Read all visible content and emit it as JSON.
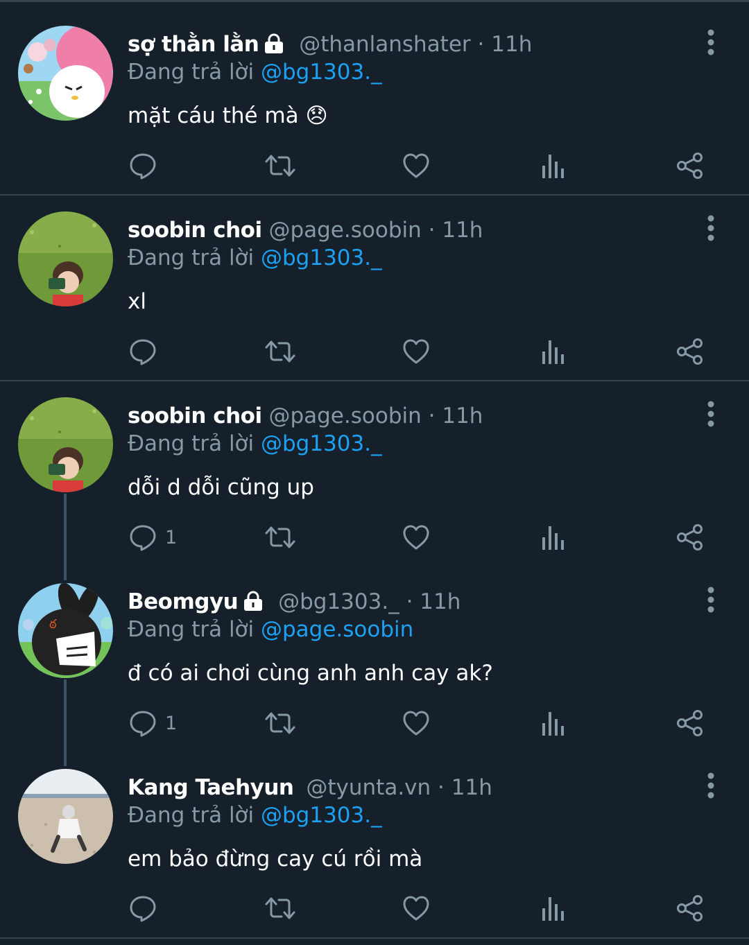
{
  "tweets": [
    {
      "name": "sợ thằn lằn",
      "handle": "@thanlanshater",
      "time": "11h",
      "locked": true,
      "reply_prefix": "Đang trả lời",
      "reply_to": "@bg1303._",
      "text": "mặt cáu thé mà 😞",
      "reply_count": ""
    },
    {
      "name": "soobin choi",
      "handle": "@page.soobin",
      "time": "11h",
      "locked": false,
      "reply_prefix": "Đang trả lời",
      "reply_to": "@bg1303._",
      "text": "xl",
      "reply_count": ""
    },
    {
      "name": "soobin choi",
      "handle": "@page.soobin",
      "time": "11h",
      "locked": false,
      "reply_prefix": "Đang trả lời",
      "reply_to": "@bg1303._",
      "text": "dỗi d dỗi cũng up",
      "reply_count": "1"
    },
    {
      "name": "Beomgyu",
      "handle": "@bg1303._",
      "time": "11h",
      "locked": true,
      "reply_prefix": "Đang trả lời",
      "reply_to": "@page.soobin",
      "text": "đ có ai chơi cùng anh anh cay ak?",
      "reply_count": "1"
    },
    {
      "name": "Kang Taehyun",
      "handle": "@tyunta.vn",
      "time": "11h",
      "locked": false,
      "reply_prefix": "Đang trả lời",
      "reply_to": "@bg1303._",
      "text": "em bảo đừng cay cú rồi mà",
      "reply_count": ""
    }
  ],
  "separator": "·",
  "icons": [
    "lock-icon",
    "more-icon",
    "reply-icon",
    "retweet-icon",
    "like-icon",
    "analytics-icon",
    "share-icon"
  ],
  "colors": {
    "background": "#15202b",
    "secondary": "#8899a6",
    "link": "#1da1f2",
    "divider": "#38444d"
  }
}
